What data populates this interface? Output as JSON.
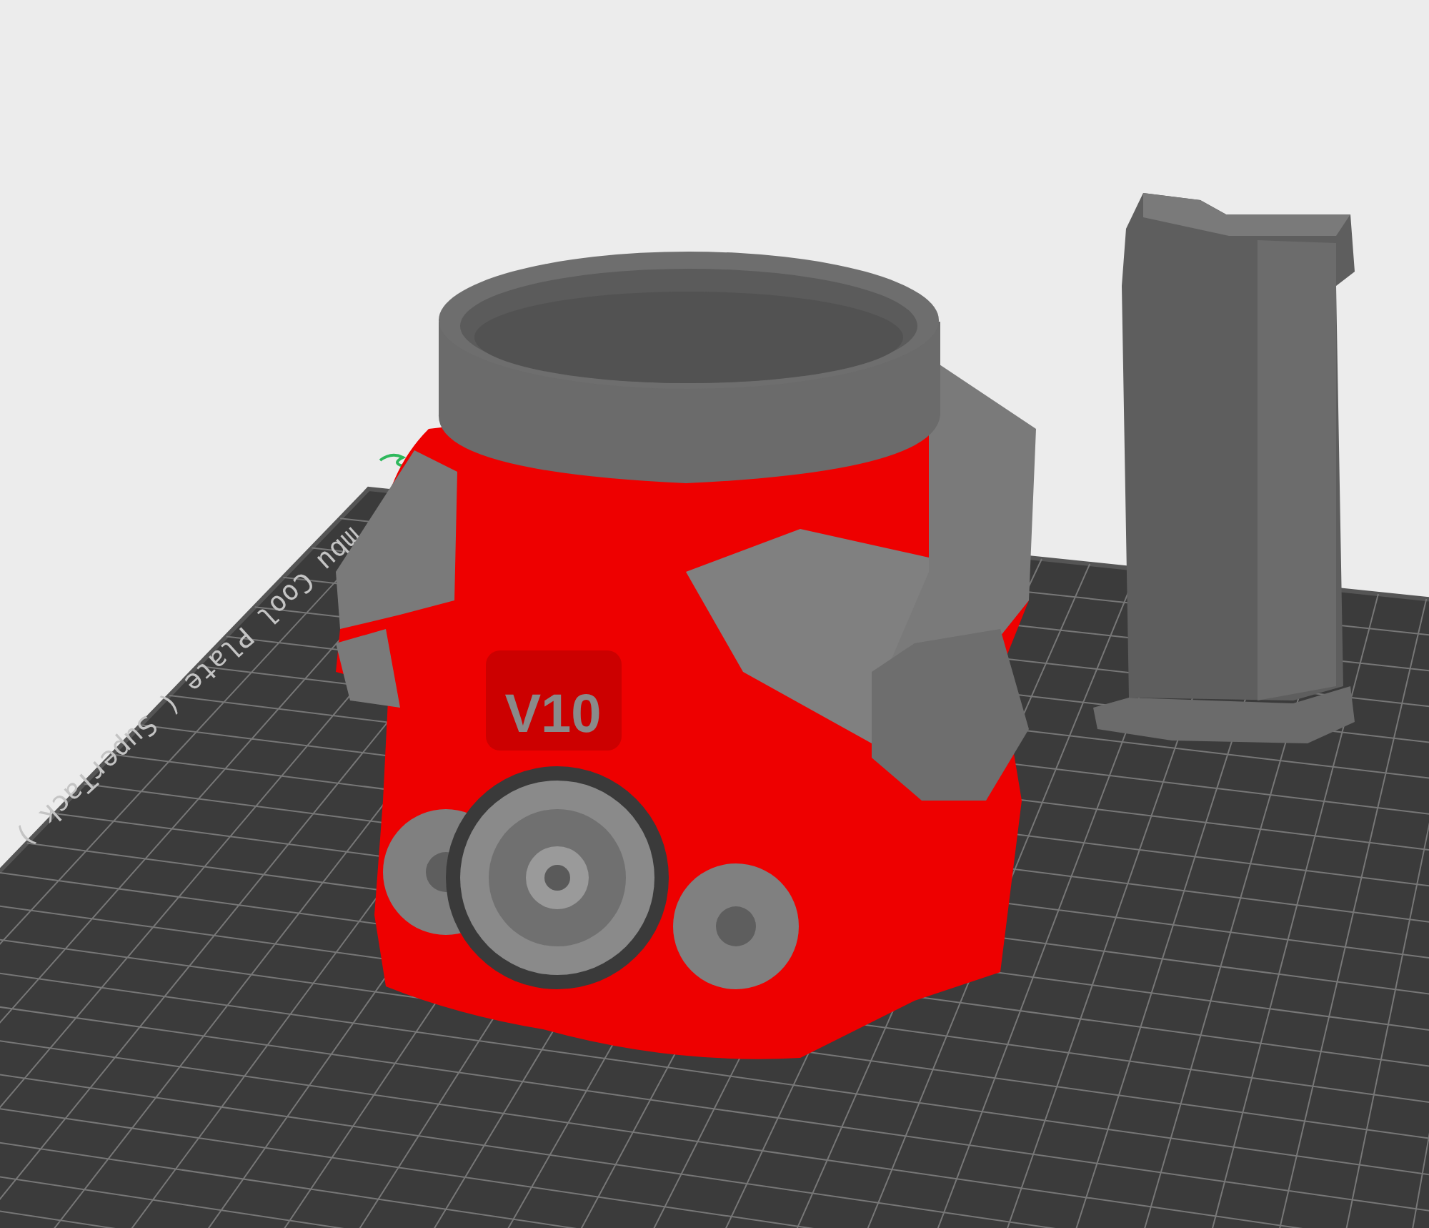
{
  "viewport": {
    "plate_label": "mbu Cool Plate ( SuperTack )",
    "model": {
      "emboss_text": "V10"
    }
  }
}
